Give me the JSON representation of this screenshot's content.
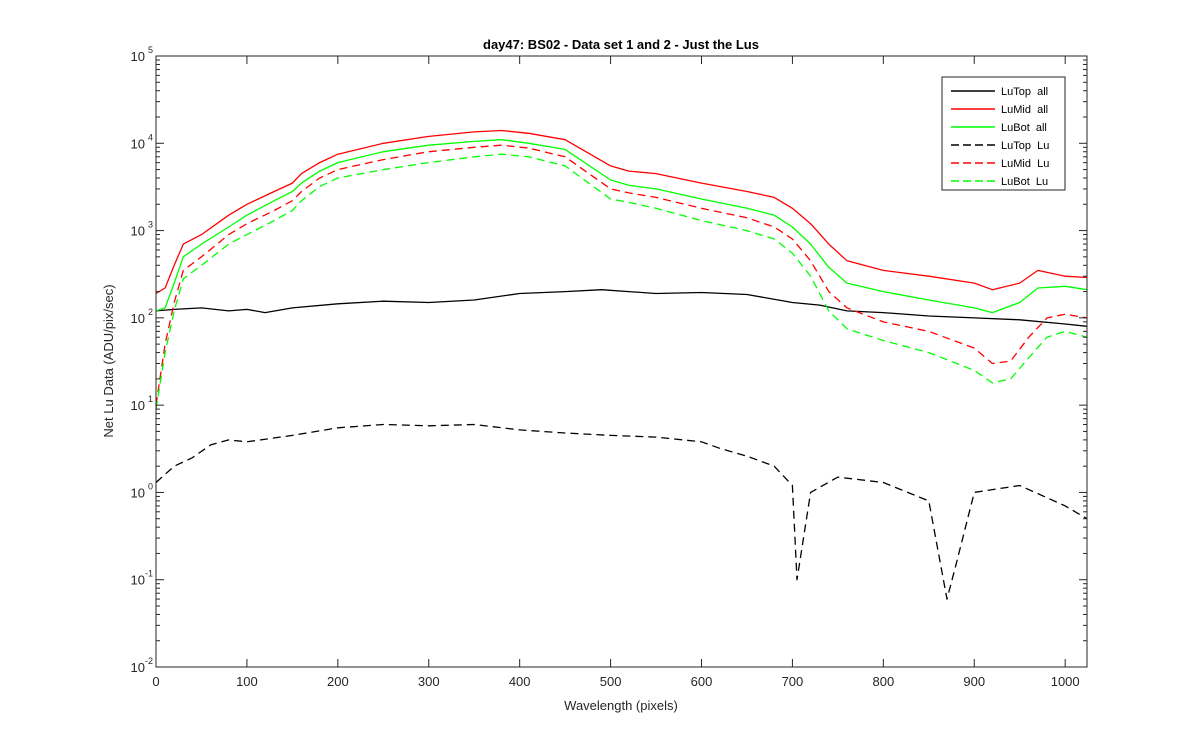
{
  "chart_data": {
    "type": "line",
    "title": "day47: BS02 - Data set 1 and 2 - Just the Lus",
    "xlabel": "Wavelength (pixels)",
    "ylabel": "Net Lu Data (ADU/pix/sec)",
    "xlim": [
      0,
      1024
    ],
    "ylim": [
      0.01,
      100000
    ],
    "yscale": "log",
    "grid": false,
    "legend_position": "top-right",
    "x_ticks": [
      0,
      100,
      200,
      300,
      400,
      500,
      600,
      700,
      800,
      900,
      1000
    ],
    "x_tick_labels": [
      "0",
      "100",
      "200",
      "300",
      "400",
      "500",
      "600",
      "700",
      "800",
      "900",
      "1000"
    ],
    "y_ticks": [
      {
        "value": 0.01,
        "base": "10",
        "exponent": "-2"
      },
      {
        "value": 0.1,
        "base": "10",
        "exponent": "-1"
      },
      {
        "value": 1,
        "base": "10",
        "exponent": "0"
      },
      {
        "value": 10,
        "base": "10",
        "exponent": "1"
      },
      {
        "value": 100,
        "base": "10",
        "exponent": "2"
      },
      {
        "value": 1000,
        "base": "10",
        "exponent": "3"
      },
      {
        "value": 10000,
        "base": "10",
        "exponent": "4"
      },
      {
        "value": 100000,
        "base": "10",
        "exponent": "5"
      }
    ],
    "series": [
      {
        "name": "LuTop  all",
        "color": "#000000",
        "dash": "solid",
        "x": [
          0,
          20,
          50,
          80,
          100,
          120,
          150,
          200,
          250,
          300,
          350,
          400,
          450,
          490,
          520,
          550,
          600,
          650,
          700,
          730,
          760,
          800,
          850,
          900,
          950,
          1000,
          1024
        ],
        "y": [
          120,
          125,
          130,
          120,
          125,
          115,
          130,
          145,
          155,
          150,
          160,
          190,
          200,
          210,
          200,
          190,
          195,
          185,
          150,
          140,
          120,
          115,
          105,
          100,
          95,
          85,
          80
        ]
      },
      {
        "name": "LuMid  all",
        "color": "#ff0000",
        "dash": "solid",
        "x": [
          0,
          10,
          20,
          30,
          50,
          80,
          100,
          130,
          150,
          160,
          180,
          200,
          250,
          300,
          350,
          380,
          410,
          450,
          500,
          520,
          550,
          600,
          650,
          680,
          700,
          720,
          740,
          760,
          800,
          850,
          900,
          920,
          950,
          970,
          1000,
          1024
        ],
        "y": [
          190,
          220,
          400,
          700,
          900,
          1500,
          2000,
          2800,
          3500,
          4500,
          6000,
          7500,
          10000,
          12000,
          13500,
          14000,
          13000,
          11000,
          5500,
          4800,
          4500,
          3500,
          2800,
          2400,
          1800,
          1200,
          700,
          450,
          350,
          300,
          250,
          210,
          250,
          350,
          300,
          290
        ]
      },
      {
        "name": "LuBot  all",
        "color": "#00ff00",
        "dash": "solid",
        "x": [
          0,
          10,
          20,
          30,
          50,
          80,
          100,
          130,
          150,
          160,
          180,
          200,
          250,
          300,
          350,
          380,
          410,
          450,
          500,
          520,
          550,
          600,
          650,
          680,
          700,
          720,
          740,
          760,
          800,
          850,
          900,
          920,
          950,
          970,
          1000,
          1024
        ],
        "y": [
          120,
          130,
          250,
          500,
          700,
          1100,
          1500,
          2200,
          2800,
          3500,
          4800,
          6000,
          8000,
          9500,
          10500,
          11000,
          10000,
          8500,
          3800,
          3300,
          3000,
          2300,
          1800,
          1500,
          1100,
          700,
          380,
          250,
          200,
          160,
          130,
          115,
          150,
          220,
          230,
          210
        ]
      },
      {
        "name": "LuTop  Lu",
        "color": "#000000",
        "dash": "dashed",
        "x": [
          0,
          20,
          40,
          60,
          80,
          100,
          150,
          200,
          250,
          300,
          350,
          400,
          450,
          500,
          550,
          600,
          620,
          650,
          680,
          700,
          705,
          720,
          750,
          800,
          850,
          870,
          880,
          900,
          950,
          1000,
          1024
        ],
        "y": [
          1.3,
          2,
          2.5,
          3.5,
          4,
          3.8,
          4.5,
          5.5,
          6,
          5.8,
          6,
          5.2,
          4.8,
          4.5,
          4.3,
          3.8,
          3.2,
          2.6,
          2,
          1.2,
          0.1,
          1,
          1.5,
          1.3,
          0.8,
          0.06,
          0.15,
          1,
          1.2,
          0.7,
          0.5
        ]
      },
      {
        "name": "LuMid  Lu",
        "color": "#ff0000",
        "dash": "dashed",
        "x": [
          0,
          10,
          20,
          30,
          50,
          80,
          100,
          130,
          150,
          160,
          180,
          200,
          250,
          300,
          350,
          380,
          410,
          450,
          500,
          520,
          550,
          600,
          650,
          680,
          700,
          720,
          740,
          760,
          800,
          850,
          900,
          920,
          940,
          960,
          980,
          1000,
          1024
        ],
        "y": [
          10,
          50,
          150,
          350,
          500,
          900,
          1200,
          1700,
          2200,
          2800,
          4000,
          5000,
          6500,
          8000,
          9000,
          9500,
          8800,
          7000,
          3000,
          2700,
          2400,
          1800,
          1400,
          1100,
          800,
          450,
          200,
          130,
          90,
          70,
          45,
          30,
          32,
          60,
          100,
          110,
          100
        ]
      },
      {
        "name": "LuBot  Lu",
        "color": "#00ff00",
        "dash": "dashed",
        "x": [
          0,
          10,
          20,
          30,
          50,
          80,
          100,
          130,
          150,
          160,
          180,
          200,
          250,
          300,
          350,
          380,
          410,
          450,
          500,
          520,
          550,
          600,
          650,
          680,
          700,
          720,
          740,
          760,
          800,
          850,
          900,
          920,
          940,
          960,
          980,
          1000,
          1024
        ],
        "y": [
          9,
          40,
          120,
          280,
          400,
          700,
          900,
          1300,
          1700,
          2200,
          3200,
          4000,
          5000,
          6000,
          7000,
          7500,
          7000,
          5500,
          2300,
          2100,
          1800,
          1300,
          1000,
          800,
          550,
          300,
          120,
          75,
          55,
          40,
          25,
          18,
          20,
          35,
          60,
          70,
          60
        ]
      }
    ]
  }
}
